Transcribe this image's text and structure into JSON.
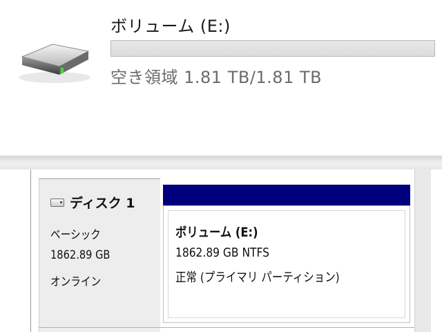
{
  "drive": {
    "icon": "hard-drive-icon",
    "title": "ボリューム (E:)",
    "usage_fraction": 0.0,
    "free_space": "空き領域 1.81 TB/1.81 TB"
  },
  "disk": {
    "icon": "disk-icon",
    "name": "ディスク 1",
    "type": "ベーシック",
    "size": "1862.89 GB",
    "status": "オンライン"
  },
  "partition": {
    "header_color": "#00007e",
    "name": "ボリューム  (E:)",
    "size_fs": "1862.89 GB NTFS",
    "status": "正常 (プライマリ パーティション)"
  }
}
